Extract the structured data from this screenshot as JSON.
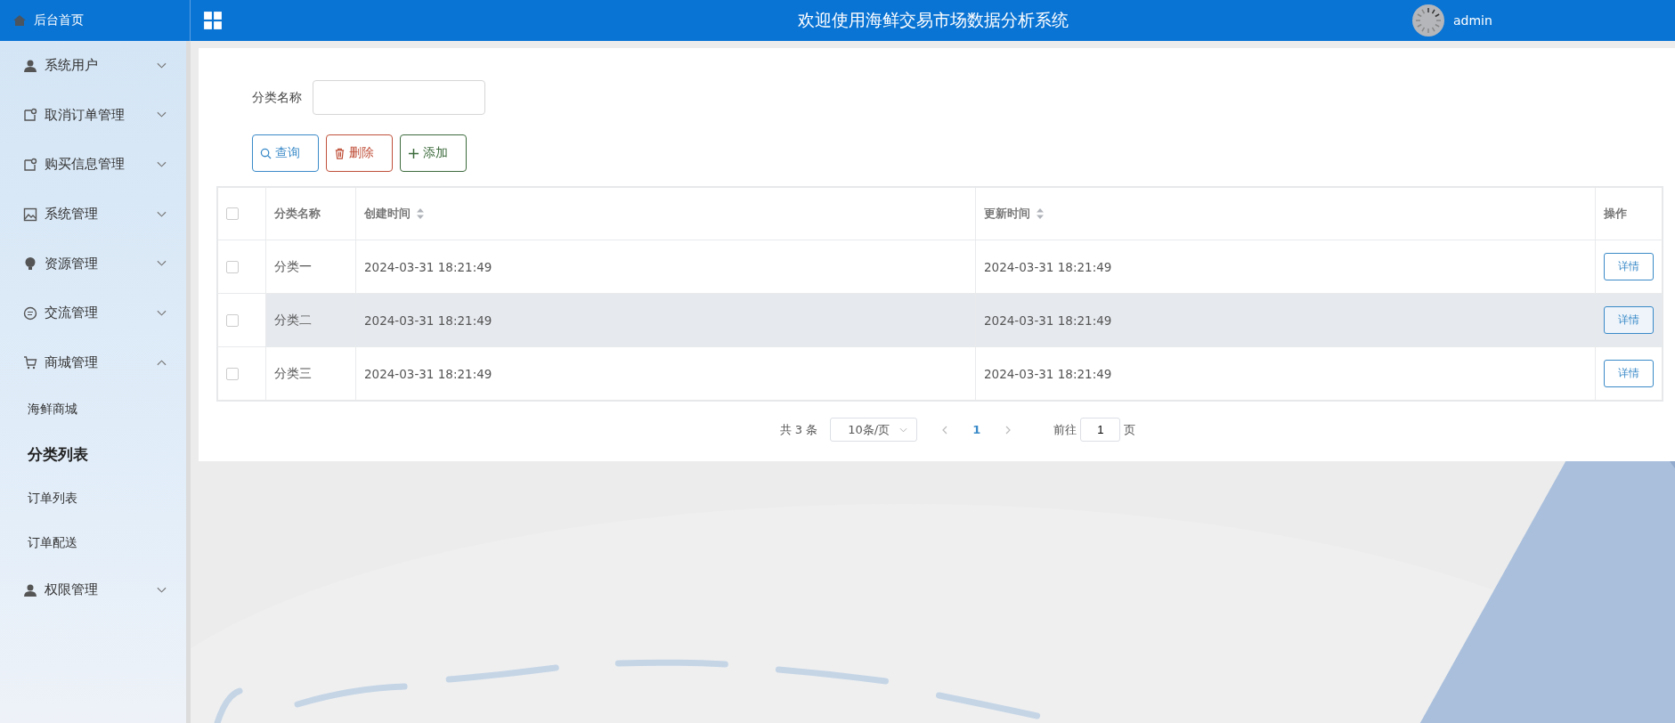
{
  "header": {
    "home_label": "后台首页",
    "title": "欢迎使用海鲜交易市场数据分析系统",
    "user": "admin"
  },
  "sidebar": {
    "items": [
      {
        "label": "系统用户",
        "expanded": false
      },
      {
        "label": "取消订单管理",
        "expanded": false
      },
      {
        "label": "购买信息管理",
        "expanded": false
      },
      {
        "label": "系统管理",
        "expanded": false
      },
      {
        "label": "资源管理",
        "expanded": false
      },
      {
        "label": "交流管理",
        "expanded": false
      },
      {
        "label": "商城管理",
        "expanded": true,
        "children": [
          {
            "label": "海鲜商城",
            "selected": false
          },
          {
            "label": "分类列表",
            "selected": true
          },
          {
            "label": "订单列表",
            "selected": false
          },
          {
            "label": "订单配送",
            "selected": false
          }
        ]
      },
      {
        "label": "权限管理",
        "expanded": false
      }
    ]
  },
  "search": {
    "label": "分类名称"
  },
  "buttons": [
    {
      "label": "查询",
      "kind": "search"
    },
    {
      "label": "删除",
      "kind": "delete"
    },
    {
      "label": "添加",
      "kind": "add"
    }
  ],
  "table": {
    "select_all_checked": false,
    "columns": [
      {
        "label": "分类名称",
        "sortable": false
      },
      {
        "label": "创建时间",
        "sortable": true
      },
      {
        "label": "更新时间",
        "sortable": true
      },
      {
        "label": "操作",
        "sortable": false
      }
    ],
    "rows": [
      {
        "checked": false,
        "highlighted": false,
        "cells": [
          "分类一",
          "2024-03-31 18:21:49",
          "2024-03-31 18:21:49"
        ],
        "action": "详情"
      },
      {
        "checked": false,
        "highlighted": true,
        "cells": [
          "分类二",
          "2024-03-31 18:21:49",
          "2024-03-31 18:21:49"
        ],
        "action": "详情"
      },
      {
        "checked": false,
        "highlighted": false,
        "cells": [
          "分类三",
          "2024-03-31 18:21:49",
          "2024-03-31 18:21:49"
        ],
        "action": "详情"
      }
    ]
  },
  "pagination": {
    "total": "共 3 条",
    "page_size": "10条/页",
    "pages": [
      {
        "label": "1",
        "selected": true
      }
    ],
    "goto_label": "前往",
    "goto_value": "1",
    "goto_suffix": "页"
  }
}
